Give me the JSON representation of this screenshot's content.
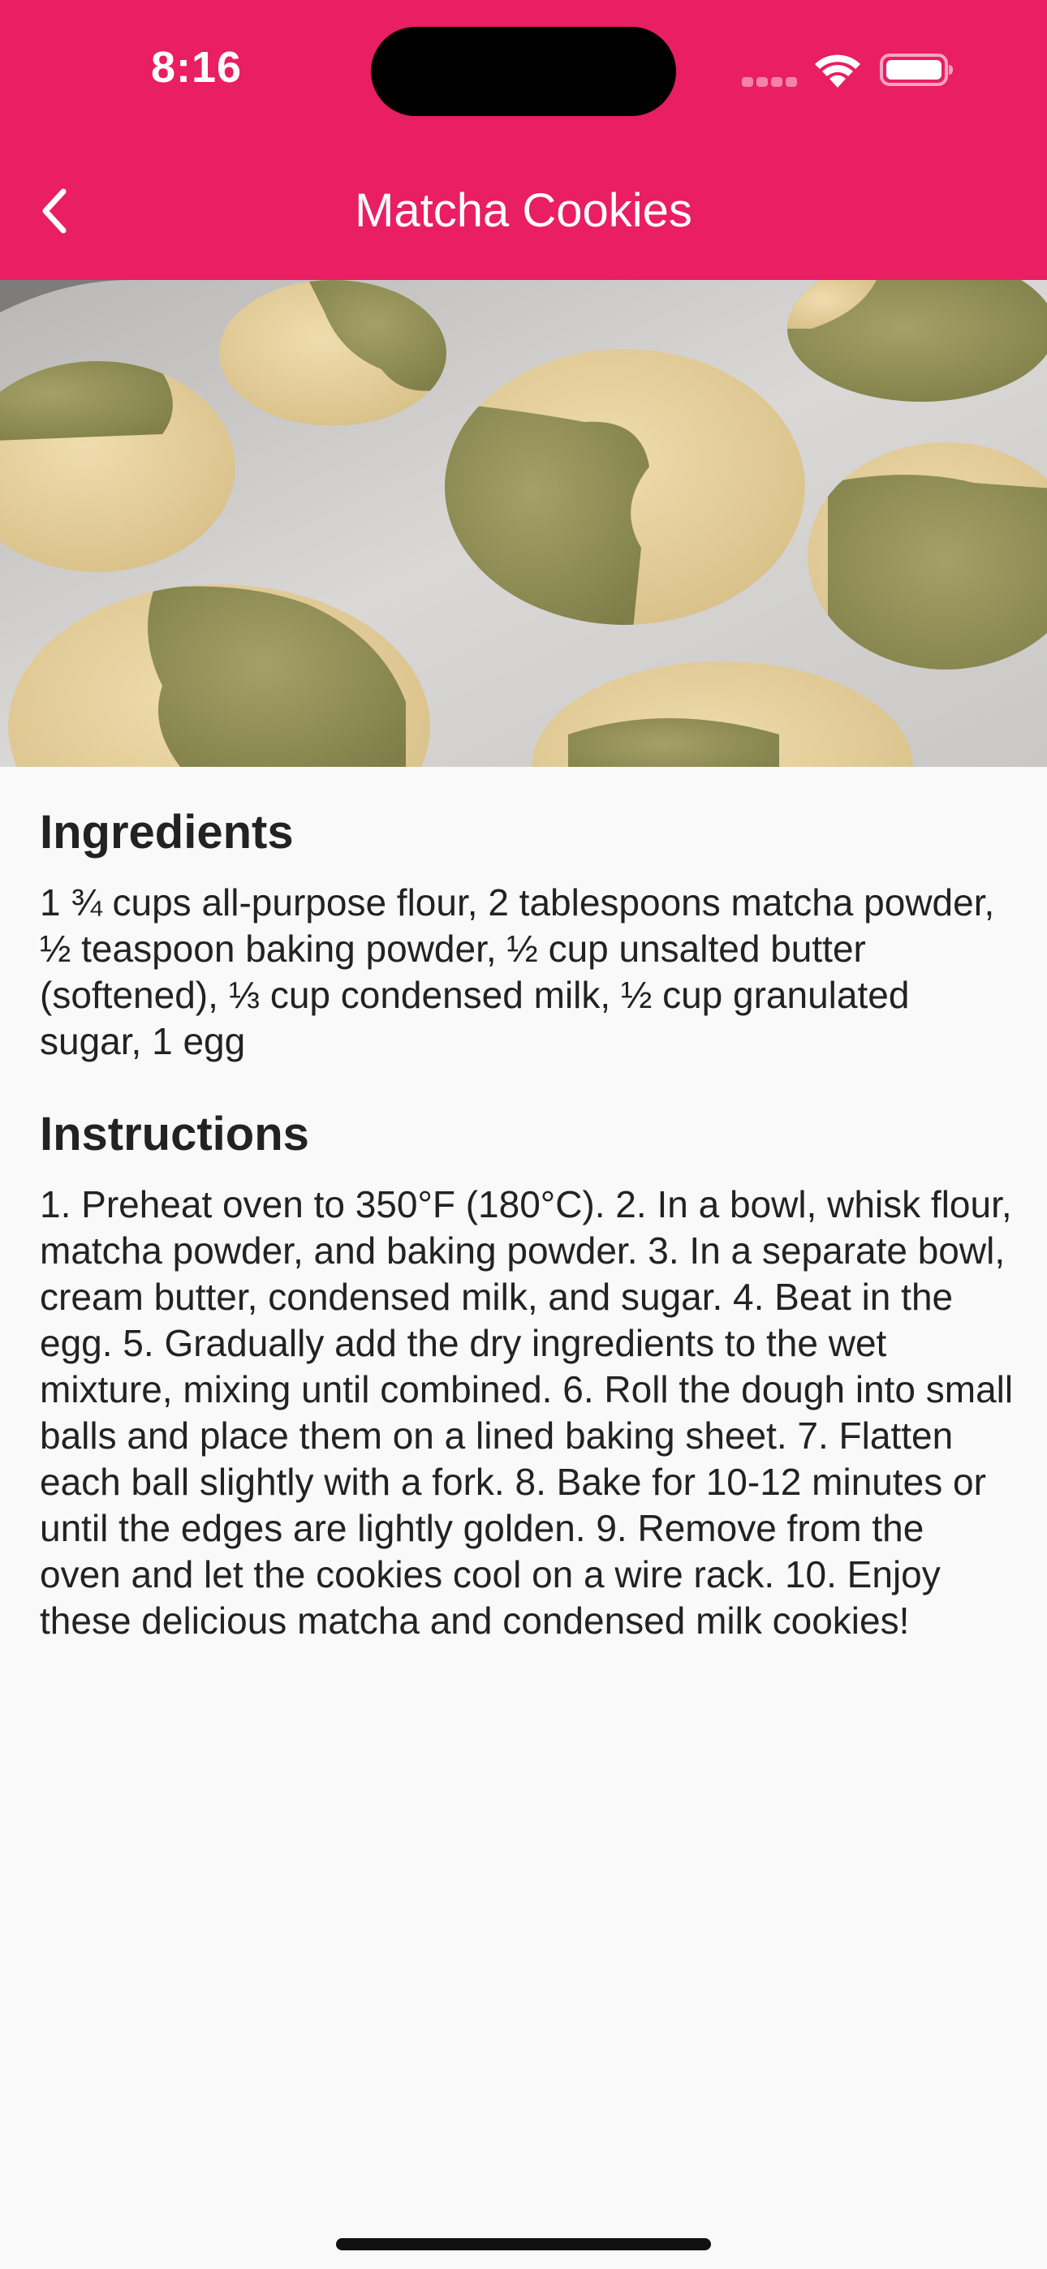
{
  "status_bar": {
    "time": "8:16"
  },
  "app_bar": {
    "title": "Matcha Cookies",
    "back_icon": "chevron-left-icon",
    "background_color": "#e91e63"
  },
  "hero_image": {
    "description": "matcha and plain two-tone cookies on baking sheet"
  },
  "ingredients": {
    "heading": "Ingredients",
    "text": "1 ¾ cups all-purpose flour, 2 tablespoons matcha powder, ½ teaspoon baking powder, ½ cup unsalted butter (softened), ⅓ cup condensed milk, ½ cup granulated sugar, 1 egg"
  },
  "instructions": {
    "heading": "Instructions",
    "text": "1. Preheat oven to 350°F (180°C). 2. In a bowl, whisk flour, matcha powder, and baking powder. 3. In a separate bowl, cream butter, condensed milk, and sugar. 4. Beat in the egg. 5. Gradually add the dry ingredients to the wet mixture, mixing until combined. 6. Roll the dough into small balls and place them on a lined baking sheet. 7. Flatten each ball slightly with a fork. 8. Bake for 10-12 minutes or until the edges are lightly golden. 9. Remove from the oven and let the cookies cool on a wire rack. 10. Enjoy these delicious matcha and condensed milk cookies!"
  }
}
